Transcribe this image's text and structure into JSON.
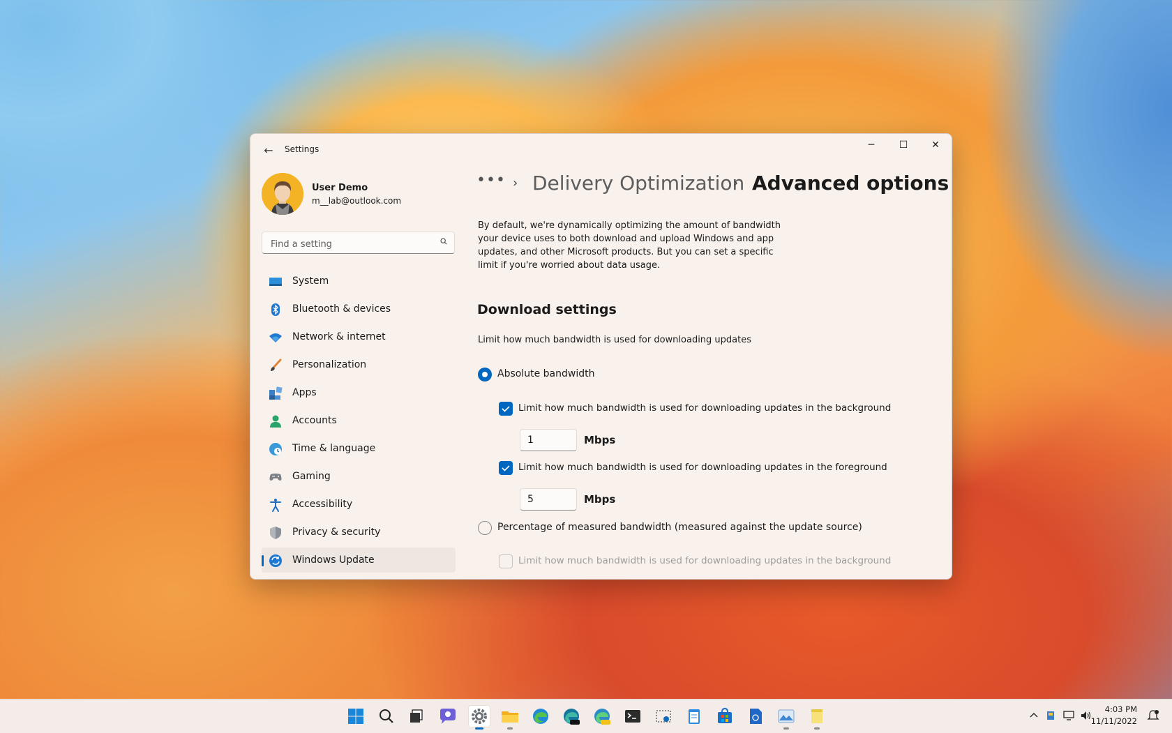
{
  "window": {
    "app_title": "Settings",
    "controls": {
      "minimize": "─",
      "maximize": "☐",
      "close": "✕"
    },
    "back": "←"
  },
  "user": {
    "name": "User Demo",
    "email": "m__lab@outlook.com"
  },
  "search": {
    "placeholder": "Find a setting"
  },
  "nav": {
    "items": [
      {
        "label": "System",
        "icon": "system-icon"
      },
      {
        "label": "Bluetooth & devices",
        "icon": "bluetooth-icon"
      },
      {
        "label": "Network & internet",
        "icon": "wifi-icon"
      },
      {
        "label": "Personalization",
        "icon": "brush-icon"
      },
      {
        "label": "Apps",
        "icon": "apps-icon"
      },
      {
        "label": "Accounts",
        "icon": "person-icon"
      },
      {
        "label": "Time & language",
        "icon": "globe-clock-icon"
      },
      {
        "label": "Gaming",
        "icon": "gamepad-icon"
      },
      {
        "label": "Accessibility",
        "icon": "accessibility-icon"
      },
      {
        "label": "Privacy & security",
        "icon": "shield-icon"
      },
      {
        "label": "Windows Update",
        "icon": "update-icon",
        "active": true
      }
    ]
  },
  "breadcrumb": {
    "more": "•••",
    "separator": "›",
    "parent": "Delivery Optimization",
    "current": "Advanced options"
  },
  "intro": "By default, we're dynamically optimizing the amount of bandwidth your device uses to both download and upload Windows and app updates, and other Microsoft products. But you can set a specific limit if you're worried about data usage.",
  "download": {
    "title": "Download settings",
    "limit_label": "Limit how much bandwidth is used for downloading updates",
    "absolute": {
      "label": "Absolute bandwidth",
      "selected": true,
      "background": {
        "label": "Limit how much bandwidth is used for downloading updates in the background",
        "checked": true,
        "value": "1",
        "unit": "Mbps"
      },
      "foreground": {
        "label": "Limit how much bandwidth is used for downloading updates in the foreground",
        "checked": true,
        "value": "5",
        "unit": "Mbps"
      }
    },
    "percentage": {
      "label": "Percentage of measured bandwidth (measured against the update source)",
      "selected": false,
      "background": {
        "label": "Limit how much bandwidth is used for downloading updates in the background",
        "checked": false,
        "disabled": true
      }
    }
  },
  "taskbar": {
    "apps": [
      "windows-start-icon",
      "search-icon",
      "task-view-icon",
      "chat-icon",
      "settings-icon",
      "file-explorer-icon",
      "edge-icon",
      "edge-beta-icon",
      "edge-canary-icon",
      "terminal-icon",
      "snipping-tool-icon",
      "notepad-icon",
      "store-icon",
      "word-doc-icon",
      "photos-icon",
      "sticky-notes-icon"
    ],
    "active_app": "settings-icon",
    "tray": [
      "chevron-up-icon",
      "usb-icon",
      "network-icon",
      "volume-icon",
      "notification-icon"
    ],
    "time": "4:03 PM",
    "date": "11/11/2022"
  },
  "colors": {
    "accent": "#0067c0",
    "window_bg": "#f8f1ec",
    "taskbar_bg": "#f4ece8"
  }
}
